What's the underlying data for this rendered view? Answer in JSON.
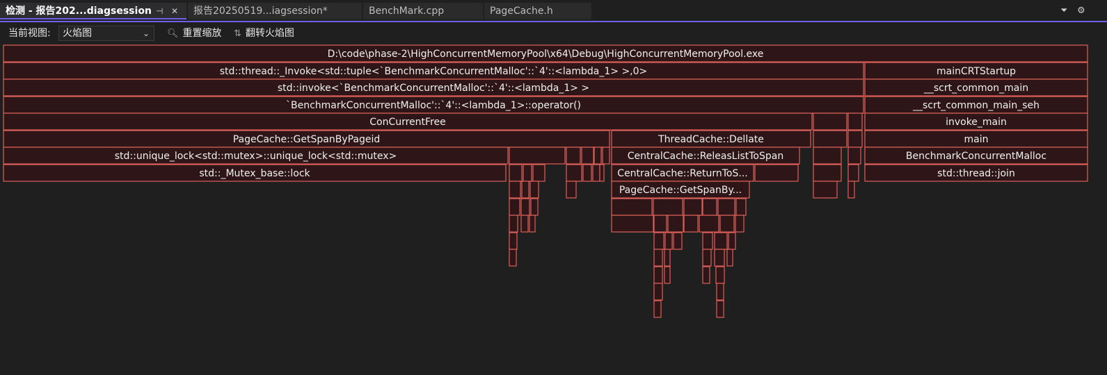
{
  "tabs": [
    {
      "label": "检测 - 报告202...diagsession",
      "active": true
    },
    {
      "label": "报告20250519...iagsession*",
      "active": false
    },
    {
      "label": "BenchMark.cpp",
      "active": false
    },
    {
      "label": "PageCache.h",
      "active": false
    }
  ],
  "tab_controls": {
    "pin": "⊣",
    "close": "✕"
  },
  "window_controls": {
    "dropdown": "⏷",
    "settings": "⚙"
  },
  "toolbar": {
    "view_label": "当前视图:",
    "view_value": "火焰图",
    "reset_zoom": "重置缩放",
    "flip_flame": "翻转火焰图"
  },
  "flame_frames": {
    "root": "D:\\code\\phase-2\\HighConcurrentMemoryPool\\x64\\Debug\\HighConcurrentMemoryPool.exe",
    "invoke_thread": "std::thread::_Invoke<std::tuple<`BenchmarkConcurrentMalloc'::`4'::<lambda_1> >,0>",
    "main_crt_startup": "mainCRTStartup",
    "std_invoke": "std::invoke<`BenchmarkConcurrentMalloc'::`4'::<lambda_1> >",
    "scrt_common_main": "__scrt_common_main",
    "lambda_operator": "`BenchmarkConcurrentMalloc'::`4'::<lambda_1>::operator()",
    "scrt_common_main_seh": "__scrt_common_main_seh",
    "concurrent_free": "ConCurrentFree",
    "invoke_main": "invoke_main",
    "get_span_by_pageid": "PageCache::GetSpanByPageid",
    "thread_cache_dellate": "ThreadCache::Dellate",
    "main": "main",
    "unique_lock": "std::unique_lock<std::mutex>::unique_lock<std::mutex>",
    "release_list_to_span": "CentralCache::ReleasListToSpan",
    "benchmark_concurrent_malloc": "BenchmarkConcurrentMalloc",
    "mutex_base_lock": "std::_Mutex_base::lock",
    "return_to_span": "CentralCache::ReturnToS...",
    "thread_join": "std::thread::join",
    "get_span_by_trunc": "PageCache::GetSpanBy..."
  }
}
